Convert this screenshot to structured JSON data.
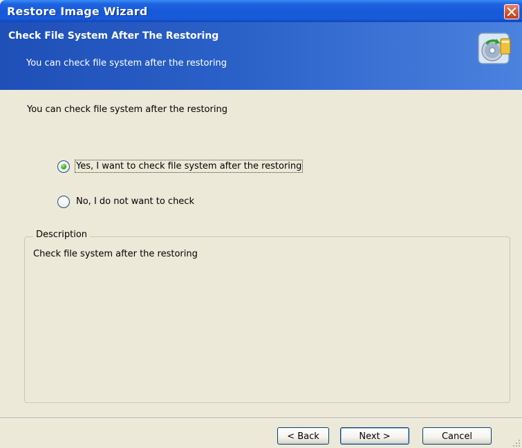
{
  "window": {
    "title": "Restore Image Wizard",
    "close_icon": "close-x-icon"
  },
  "header": {
    "title": "Check File System After The Restoring",
    "subtitle": "You can check file system after the restoring",
    "icon": "restore-disk-icon"
  },
  "body": {
    "lead_text": "You can check file system after the restoring",
    "options": [
      {
        "label": "Yes, I want to check file system after the restoring",
        "selected": true
      },
      {
        "label": "No, I do not want to check",
        "selected": false
      }
    ]
  },
  "description": {
    "legend": "Description",
    "text": "Check file system after the restoring"
  },
  "buttons": {
    "back": "< Back",
    "next": "Next >",
    "cancel": "Cancel"
  },
  "colors": {
    "titlebar": "#1559db",
    "banner": "#2a61c8",
    "dialog_bg": "#ece9d8",
    "radio_selected": "#3fb427"
  }
}
